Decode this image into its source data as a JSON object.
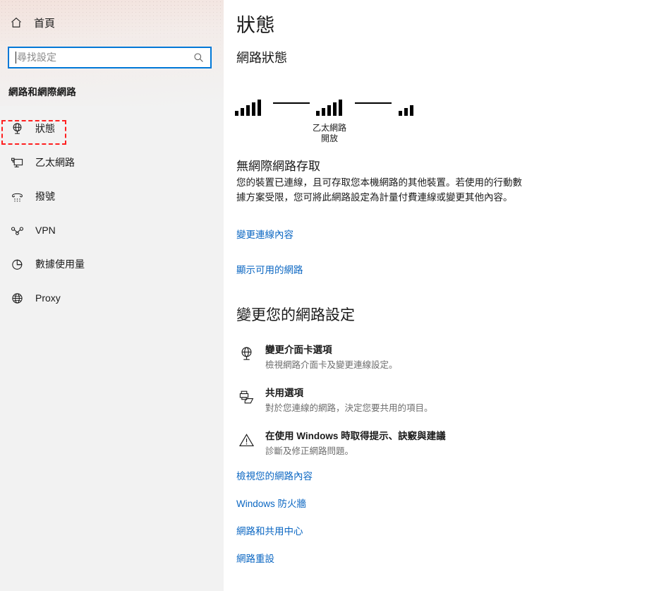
{
  "sidebar": {
    "home": {
      "label": "首頁",
      "icon": "home-icon"
    },
    "search": {
      "value": "",
      "placeholder": "尋找設定",
      "icon": "search-icon"
    },
    "category_title": "網路和網際網路",
    "items": [
      {
        "label": "狀態",
        "icon": "network-globe-icon",
        "selected": true
      },
      {
        "label": "乙太網路",
        "icon": "ethernet-monitor-icon",
        "selected": false
      },
      {
        "label": "撥號",
        "icon": "dialup-phone-icon",
        "selected": false
      },
      {
        "label": "VPN",
        "icon": "vpn-key-icon",
        "selected": false
      },
      {
        "label": "數據使用量",
        "icon": "data-usage-pie-icon",
        "selected": false
      },
      {
        "label": "Proxy",
        "icon": "proxy-globe-icon",
        "selected": false
      }
    ]
  },
  "content": {
    "page_title": "狀態",
    "network_status_heading": "網路狀態",
    "diagram": {
      "device_bars": [
        7,
        11,
        15,
        19,
        23
      ],
      "network_bars": [
        7,
        11,
        15,
        19,
        23
      ],
      "internet_bars": [
        7,
        11,
        15
      ],
      "label_line1": "乙太網路",
      "label_line2": "開放"
    },
    "status_heading": "無網際網路存取",
    "status_description": "您的裝置已連線，且可存取您本機網路的其他裝置。若使用的行動數據方案受限，您可將此網路設定為計量付費連線或變更其他內容。",
    "link_change_properties": "變更連線內容",
    "link_show_networks": "顯示可用的網路",
    "change_settings_heading": "變更您的網路設定",
    "options": [
      {
        "title": "變更介面卡選項",
        "description": "檢視網路介面卡及變更連線設定。",
        "icon": "adapter-globe-icon"
      },
      {
        "title": "共用選項",
        "description": "對於您連線的網路，決定您要共用的項目。",
        "icon": "sharing-printer-icon"
      },
      {
        "title": "在使用 Windows 時取得提示、訣竅與建議",
        "description": "診斷及修正網路問題。",
        "icon": "warning-triangle-icon"
      }
    ],
    "footer_links": [
      "檢視您的網路內容",
      "Windows 防火牆",
      "網路和共用中心",
      "網路重設"
    ]
  },
  "colors": {
    "accent_blue": "#0a66c2",
    "focus_border": "#0078d7",
    "highlight_red": "#ff2020",
    "sidebar_bg": "#f2f2f2"
  }
}
